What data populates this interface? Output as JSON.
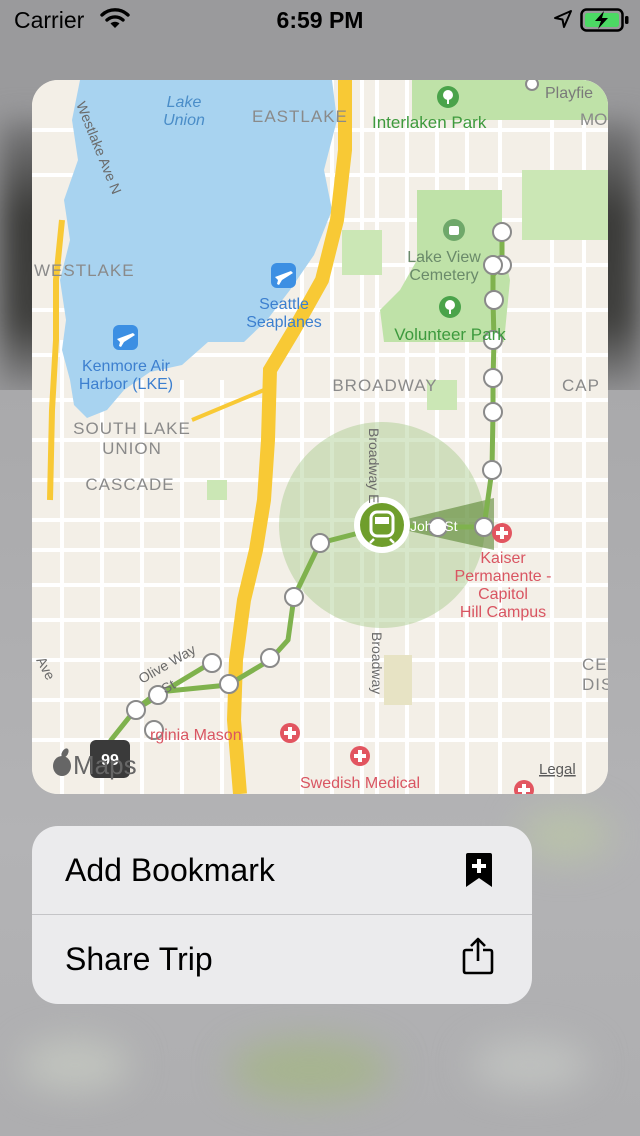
{
  "status_bar": {
    "carrier": "Carrier",
    "time": "6:59 PM"
  },
  "map": {
    "labels": {
      "lake_union_1": "Lake",
      "lake_union_2": "Union",
      "eastlake": "EASTLAKE",
      "interlaken_park": "Interlaken Park",
      "playfield": "Playfie",
      "mo": "MO",
      "westlake_ave": "Westlake Ave N",
      "westlake": "WESTLAKE",
      "seattle_seaplanes_1": "Seattle",
      "seattle_seaplanes_2": "Seaplanes",
      "lake_view_cemetery_1": "Lake View",
      "lake_view_cemetery_2": "Cemetery",
      "volunteer_park": "Volunteer Park",
      "kenmore_1": "Kenmore Air",
      "kenmore_2": "Harbor (LKE)",
      "broadway_area": "BROADWAY",
      "cap": "CAP",
      "south_lake_union_1": "SOUTH LAKE",
      "south_lake_union_2": "UNION",
      "cascade": "CASCADE",
      "broadway_e": "Broadway E",
      "john_st": "John St",
      "kaiser_1": "Kaiser",
      "kaiser_2": "Permanente -",
      "kaiser_3": "Capitol",
      "kaiser_4": "Hill Campus",
      "broadway_street": "Broadway",
      "olive_way": "Olive Way",
      "st": "St",
      "ave": "Ave",
      "ce": "CE",
      "dis": "DIS",
      "virginia_mason": "rginia Mason",
      "swedish_medical": "Swedish Medical",
      "route_badge": "99",
      "maps_brand": "Maps",
      "legal": "Legal"
    }
  },
  "menu": {
    "items": [
      {
        "label": "Add Bookmark",
        "icon": "bookmark-add-icon"
      },
      {
        "label": "Share Trip",
        "icon": "share-icon"
      }
    ]
  },
  "colors": {
    "water": "#a8d3f0",
    "park": "#bfe2a8",
    "route": "#7fb24e",
    "vehicle": "#6f9e2c",
    "highway": "#f8c935",
    "poi_green": "#4aa34a",
    "poi_blue": "#3c8fe3",
    "poi_red": "#e25560"
  }
}
